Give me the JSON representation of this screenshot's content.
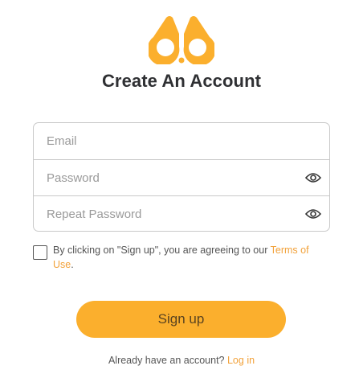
{
  "brand": {
    "logo_icon": "binoculars-logo-icon",
    "accent_color": "#fbaf2d"
  },
  "page": {
    "title": "Create An Account"
  },
  "form": {
    "email_placeholder": "Email",
    "password_placeholder": "Password",
    "repeat_password_placeholder": "Repeat Password",
    "show_password_icon": "eye-icon"
  },
  "terms": {
    "text_before": "By clicking on \"Sign up\", you are agreeing to our ",
    "link_text": "Terms of Use",
    "text_after": "."
  },
  "actions": {
    "signup_label": "Sign up"
  },
  "footer": {
    "prompt": "Already have an account? ",
    "login_link": "Log in"
  }
}
